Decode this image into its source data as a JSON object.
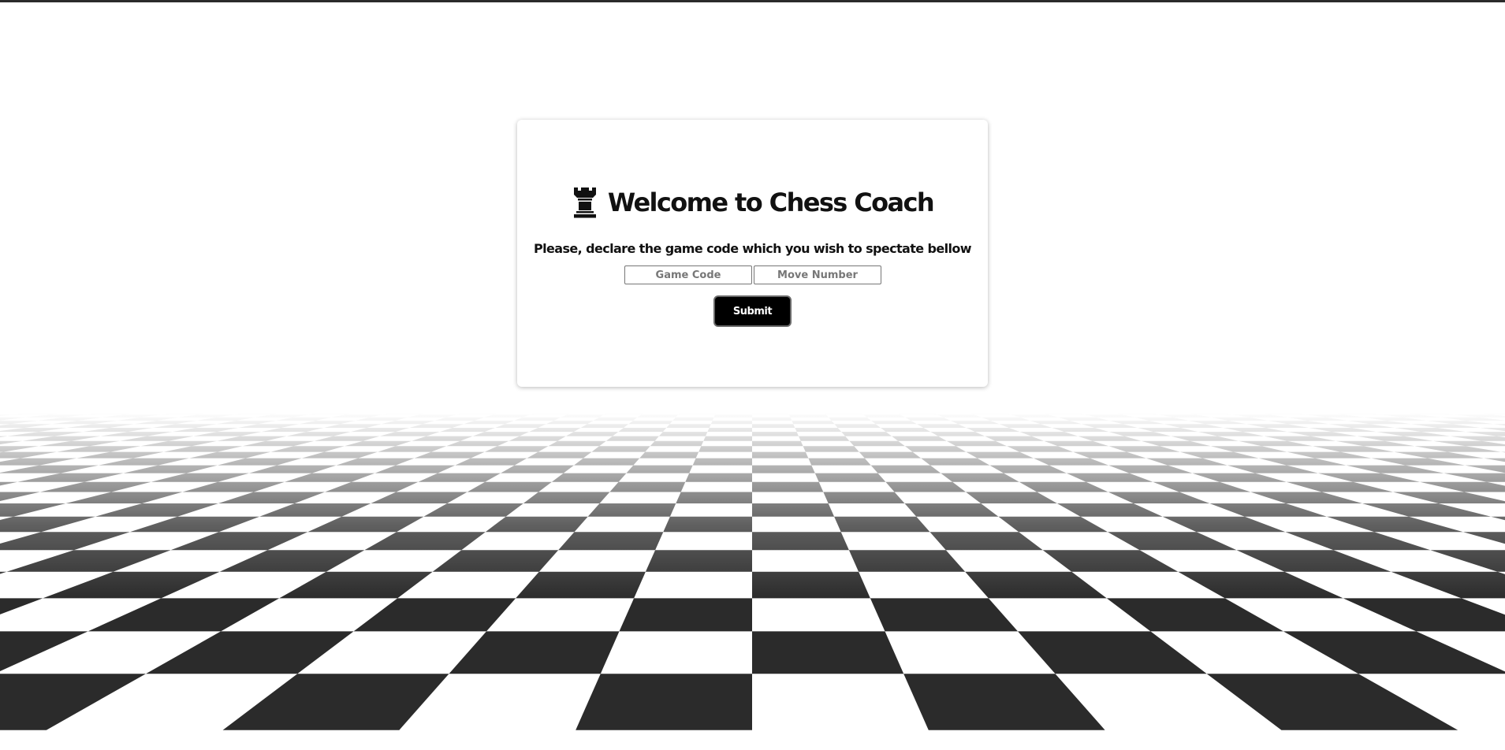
{
  "header": {
    "icon": "rook-icon",
    "title": "Welcome to Chess Coach"
  },
  "form": {
    "prompt": "Please, declare the game code which you wish to spectate bellow",
    "game_code": {
      "value": "",
      "placeholder": "Game Code"
    },
    "move_number": {
      "value": "",
      "placeholder": "Move Number"
    },
    "submit_label": "Submit"
  },
  "background": {
    "pattern": "perspective-checkerboard",
    "dark_color": "#2b2b2b",
    "light_color": "#ffffff"
  }
}
